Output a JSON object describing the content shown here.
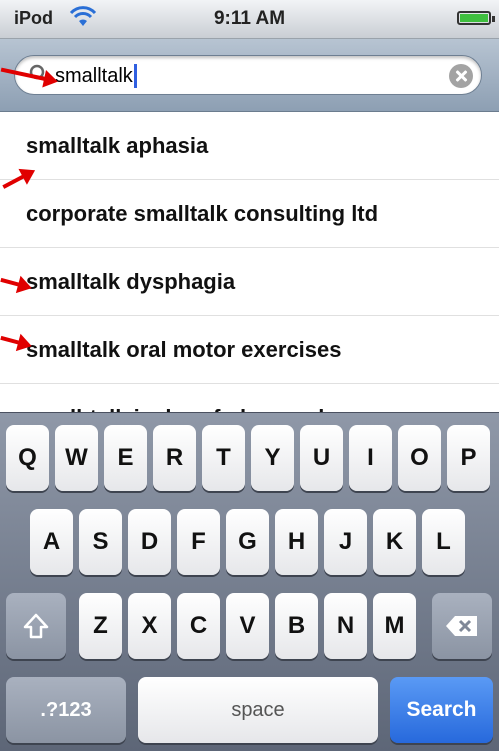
{
  "status_bar": {
    "carrier": "iPod",
    "time": "9:11 AM"
  },
  "search": {
    "value": "smalltalk"
  },
  "suggestions": [
    "smalltalk aphasia",
    "corporate smalltalk consulting ltd",
    "smalltalk dysphagia",
    "smalltalk oral motor exercises",
    "small-talk im beruf - leseprobe"
  ],
  "keyboard": {
    "row1": [
      "Q",
      "W",
      "E",
      "R",
      "T",
      "Y",
      "U",
      "I",
      "O",
      "P"
    ],
    "row2": [
      "A",
      "S",
      "D",
      "F",
      "G",
      "H",
      "J",
      "K",
      "L"
    ],
    "row3": [
      "Z",
      "X",
      "C",
      "V",
      "B",
      "N",
      "M"
    ],
    "numbers_key": ".?123",
    "space_key": "space",
    "search_key": "Search"
  },
  "colors": {
    "annotation_arrow": "#e00000",
    "search_key": "#2769dc",
    "caret": "#2f5fe0"
  }
}
